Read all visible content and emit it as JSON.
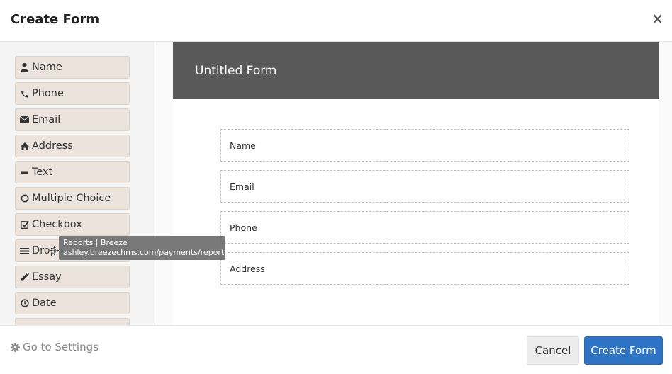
{
  "dialog": {
    "title": "Create Form",
    "close_glyph": "×"
  },
  "sidebar": {
    "items": [
      {
        "label": "Name",
        "icon": "user-icon"
      },
      {
        "label": "Phone",
        "icon": "phone-icon"
      },
      {
        "label": "Email",
        "icon": "envelope-icon"
      },
      {
        "label": "Address",
        "icon": "home-icon"
      },
      {
        "label": "Text",
        "icon": "minus-icon"
      },
      {
        "label": "Multiple Choice",
        "icon": "radio-icon"
      },
      {
        "label": "Checkbox",
        "icon": "checkbox-icon"
      },
      {
        "label": "Drop",
        "icon": "list-icon"
      },
      {
        "label": "Essay",
        "icon": "pencil-icon"
      },
      {
        "label": "Date",
        "icon": "clock-icon"
      }
    ]
  },
  "tooltip": {
    "line1": "Reports | Breeze",
    "line2": "ashley.breezechms.com/payments/reports"
  },
  "form": {
    "title": "Untitled Form",
    "fields": [
      "Name",
      "Email",
      "Phone",
      "Address"
    ]
  },
  "footer": {
    "settings_label": "Go to Settings",
    "cancel_label": "Cancel",
    "create_label": "Create Form"
  },
  "colors": {
    "primary": "#2e73c4",
    "form_header": "#595959",
    "field_button": "#ece4dc"
  }
}
